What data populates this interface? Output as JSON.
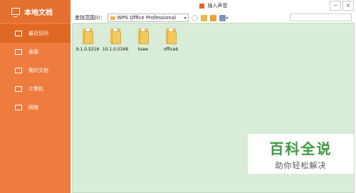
{
  "sidebar": {
    "title": "本地文档",
    "items": [
      {
        "label": "最近访问",
        "icon": "recent-icon"
      },
      {
        "label": "桌面",
        "icon": "desktop-icon"
      },
      {
        "label": "我的文档",
        "icon": "my-documents-icon"
      },
      {
        "label": "计算机",
        "icon": "computer-icon"
      },
      {
        "label": "网络",
        "icon": "network-icon"
      }
    ]
  },
  "window": {
    "title": "插入声音",
    "minimize_glyph": "−",
    "close_glyph": "×"
  },
  "toolbar": {
    "range_label": "查找范围(I)：",
    "range_value": "WPS Office Professional",
    "dropdown_glyph": "▾"
  },
  "files": [
    {
      "name": "9.1.0.5218",
      "icon": "folder-icon"
    },
    {
      "name": "10.1.0.5346",
      "icon": "folder-icon"
    },
    {
      "name": "ksee",
      "icon": "folder-icon"
    },
    {
      "name": "office6",
      "icon": "folder-icon"
    }
  ],
  "watermark": {
    "title": "百科全说",
    "subtitle": "助你轻松解决"
  },
  "colors": {
    "sidebar_bg": "#ee7c3f",
    "content_bg": "#d8ecd7",
    "watermark_green": "#3c9a3c"
  }
}
